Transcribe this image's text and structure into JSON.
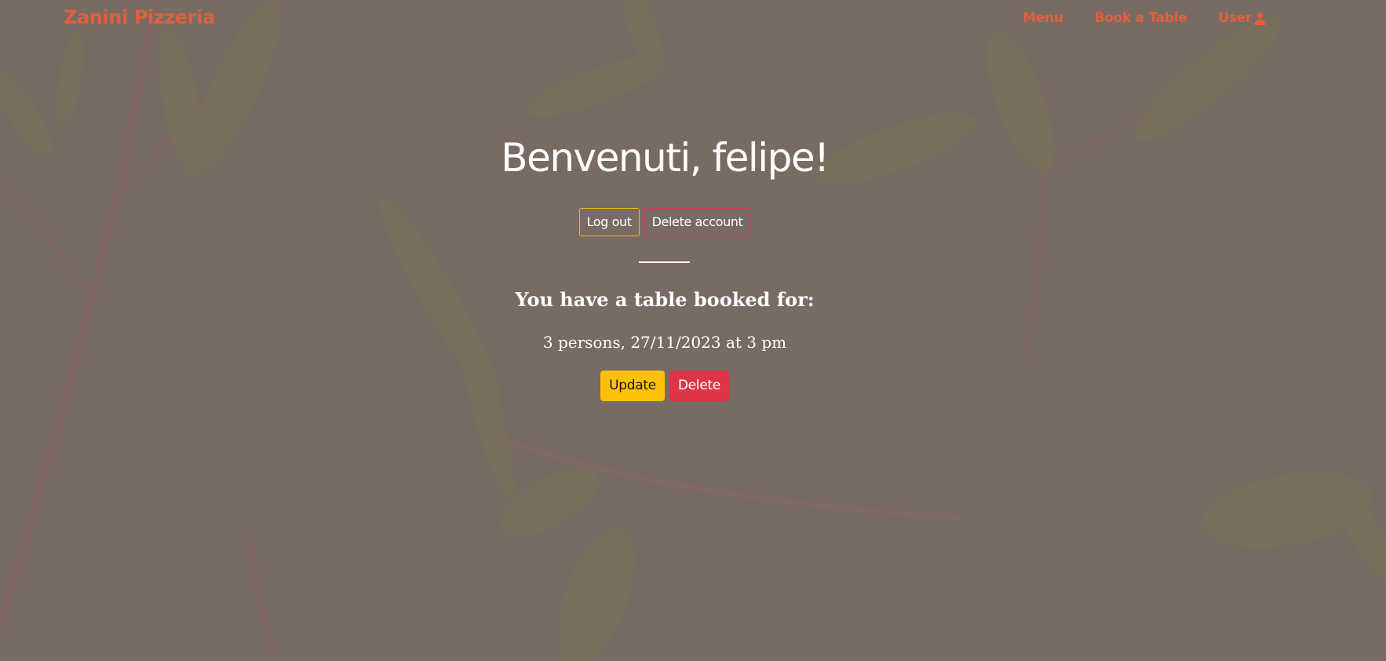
{
  "navbar": {
    "brand": "Zanini Pizzeria",
    "links": [
      {
        "label": "Menu"
      },
      {
        "label": "Book a Table"
      },
      {
        "label": "User",
        "icon": "user-icon"
      }
    ]
  },
  "profile": {
    "greeting": "Benvenuti, felipe!",
    "logout_label": "Log out",
    "delete_account_label": "Delete account"
  },
  "booking": {
    "heading": "You have a table booked for:",
    "details": "3 persons, 27/11/2023 at 3 pm",
    "update_label": "Update",
    "delete_label": "Delete"
  },
  "colors": {
    "brand": "#e0603c",
    "overlay": "#7c6f66",
    "update_button": "#ffc107",
    "delete_button": "#dc3545",
    "logout_border": "#e8b81c",
    "delete_account_border": "#d23a48"
  }
}
